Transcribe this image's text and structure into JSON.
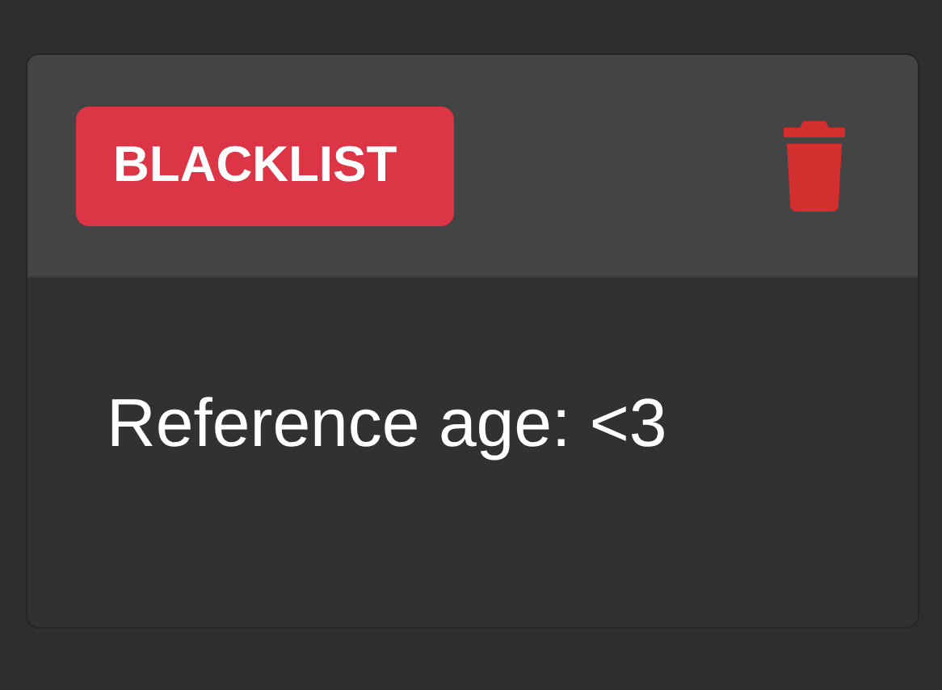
{
  "card": {
    "badge": "BLACKLIST",
    "text": "Reference age: <3"
  }
}
